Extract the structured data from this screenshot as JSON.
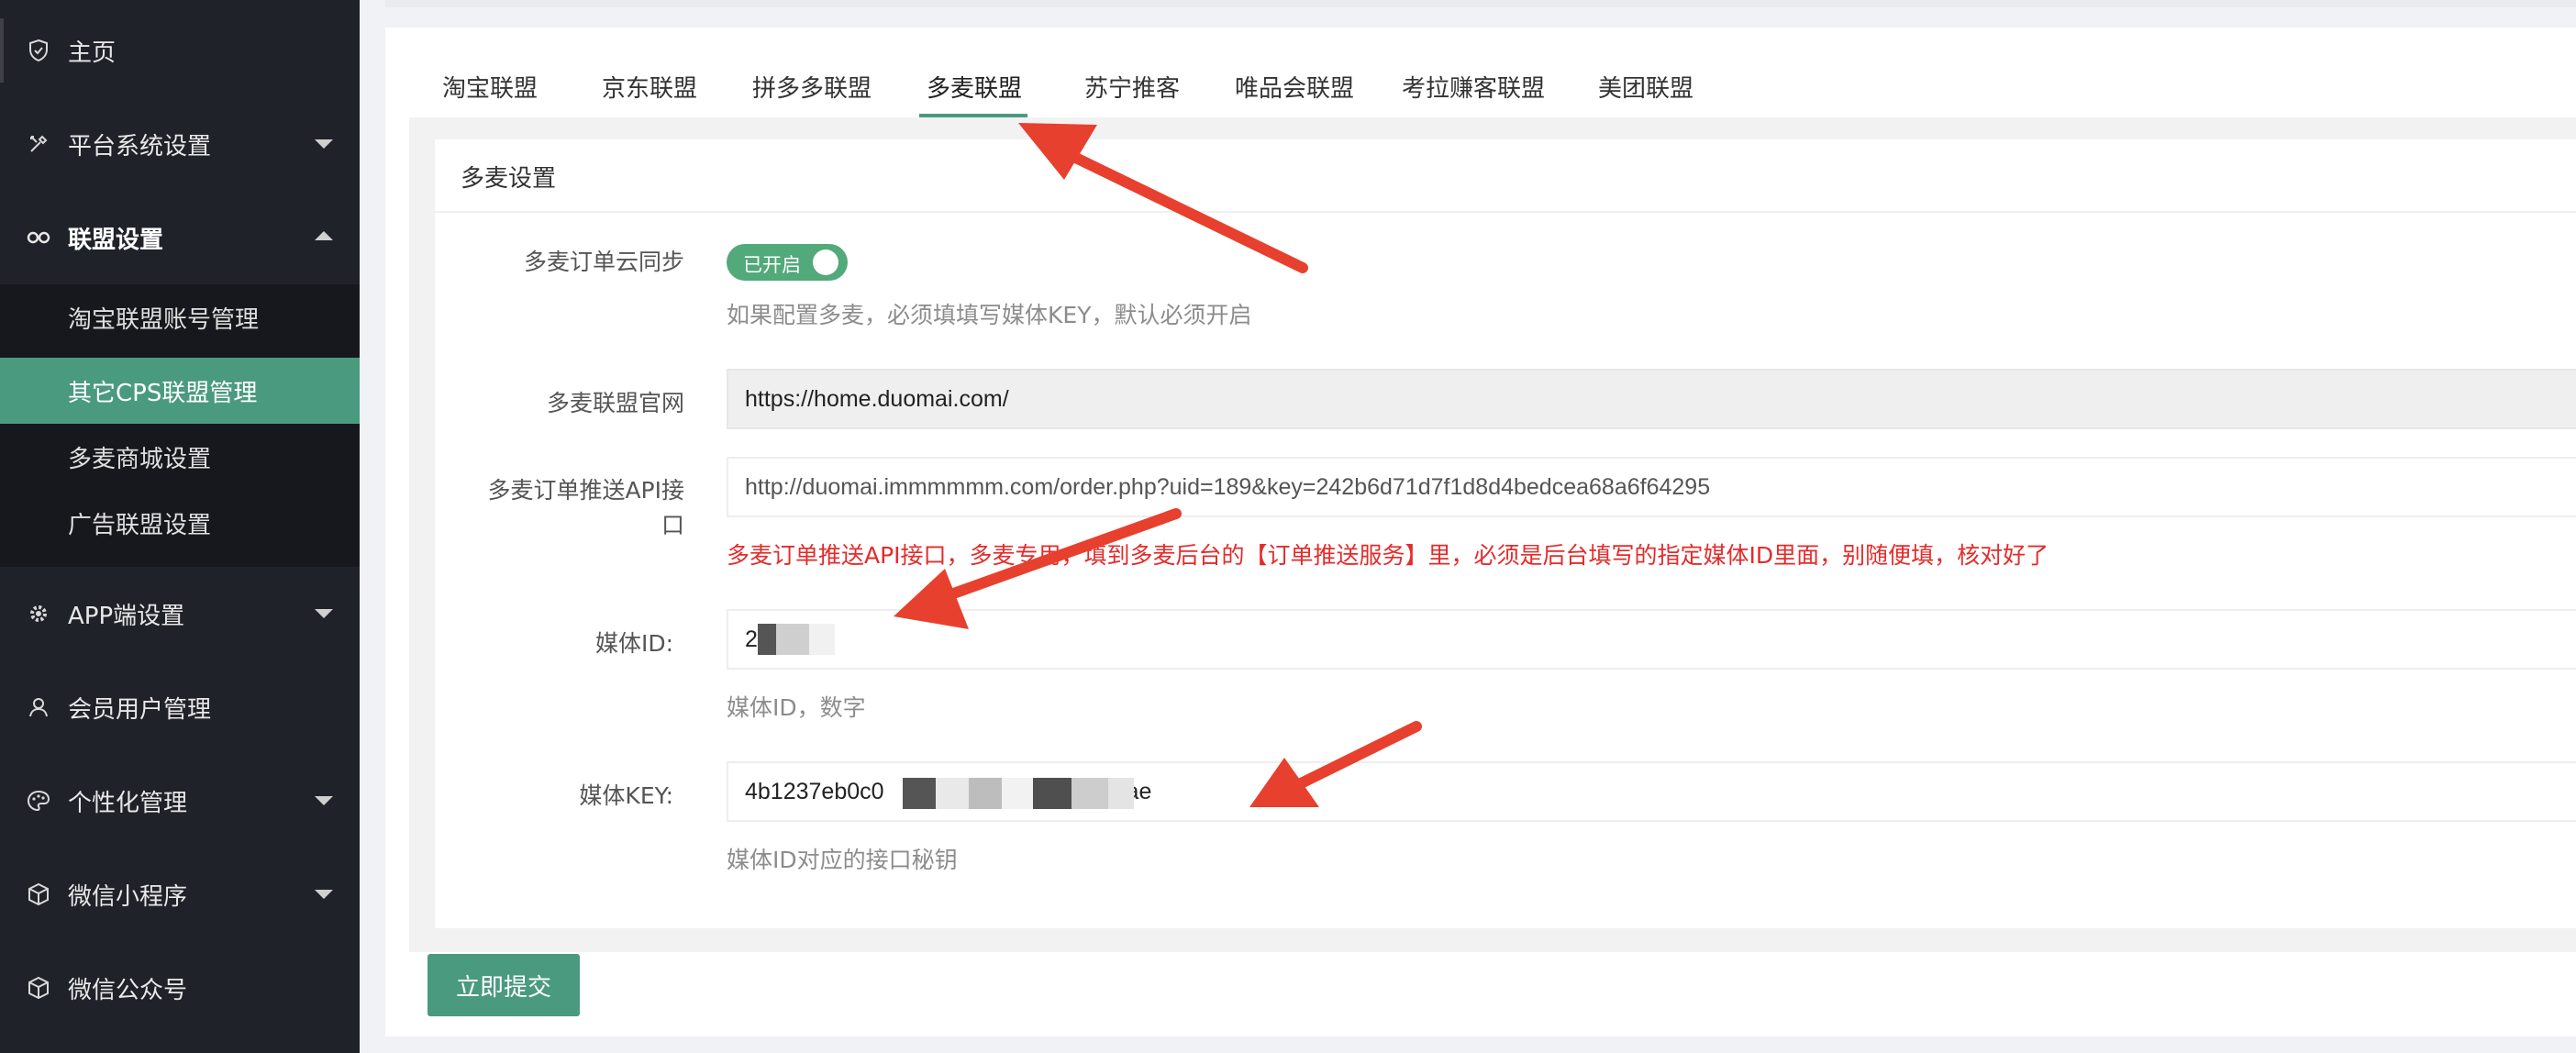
{
  "sidebar": {
    "items": [
      {
        "label": "主页",
        "icon": "shield-icon"
      },
      {
        "label": "平台系统设置",
        "icon": "tools-icon"
      },
      {
        "label": "联盟设置",
        "icon": "link-icon"
      },
      {
        "label": "APP端设置",
        "icon": "gear-icon"
      },
      {
        "label": "会员用户管理",
        "icon": "user-icon"
      },
      {
        "label": "个性化管理",
        "icon": "palette-icon"
      },
      {
        "label": "微信小程序",
        "icon": "cube-icon"
      },
      {
        "label": "微信公众号",
        "icon": "cube-icon"
      }
    ],
    "submenu": [
      {
        "label": "淘宝联盟账号管理"
      },
      {
        "label": "其它CPS联盟管理"
      },
      {
        "label": "多麦商城设置"
      },
      {
        "label": "广告联盟设置"
      }
    ]
  },
  "tabs": [
    {
      "label": "淘宝联盟"
    },
    {
      "label": "京东联盟"
    },
    {
      "label": "拼多多联盟"
    },
    {
      "label": "多麦联盟"
    },
    {
      "label": "苏宁推客"
    },
    {
      "label": "唯品会联盟"
    },
    {
      "label": "考拉赚客联盟"
    },
    {
      "label": "美团联盟"
    }
  ],
  "panel": {
    "title": "多麦设置"
  },
  "form": {
    "sync": {
      "label": "多麦订单云同步",
      "toggle_text": "已开启",
      "help": "如果配置多麦，必须填填写媒体KEY，默认必须开启"
    },
    "site": {
      "label": "多麦联盟官网",
      "value": "https://home.duomai.com/"
    },
    "api": {
      "label_line1": "多麦订单推送API接",
      "label_line2": "口",
      "value": "http://duomai.immmmmm.com/order.php?uid=189&key=242b6d71d7f1d8d4bedcea68a6f64295",
      "help": "多麦订单推送API接口，多麦专用，填到多麦后台的【订单推送服务】里，必须是后台填写的指定媒体ID里面，别随便填，核对好了"
    },
    "media_id": {
      "label": "媒体ID:",
      "value": "2",
      "help": "媒体ID，数字"
    },
    "media_key": {
      "label": "媒体KEY:",
      "value_prefix": "4b1237eb0c0",
      "value_suffix": "ae",
      "help": "媒体ID对应的接口秘钥"
    }
  },
  "submit_label": "立即提交",
  "colors": {
    "sidebar_bg": "#20222a",
    "accent": "#4a9a80",
    "toggle_on": "#52a97a",
    "error_red": "#e42b2b",
    "annotation_arrow": "#e8402e"
  }
}
